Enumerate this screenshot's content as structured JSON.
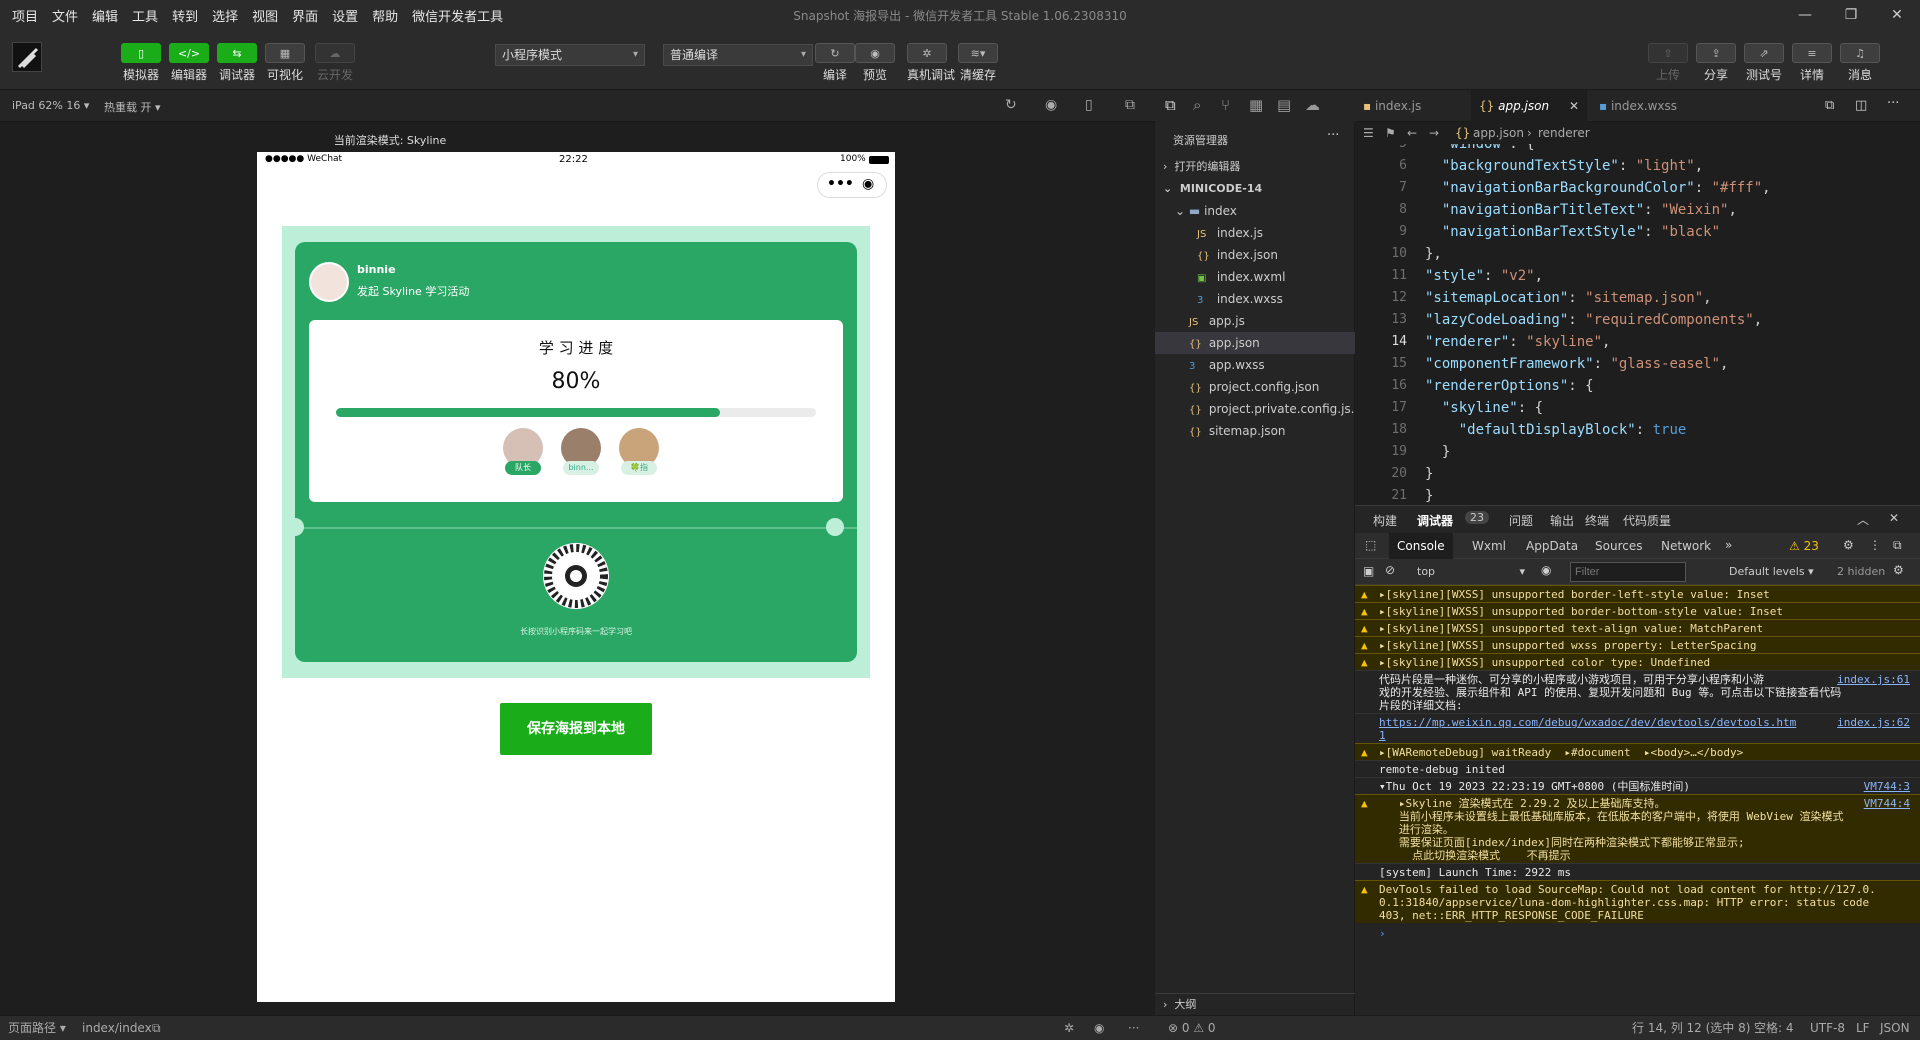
{
  "menu": [
    "项目",
    "文件",
    "编辑",
    "工具",
    "转到",
    "选择",
    "视图",
    "界面",
    "设置",
    "帮助",
    "微信开发者工具"
  ],
  "window_title": "Snapshot 海报导出 - 微信开发者工具 Stable 1.06.2308310",
  "toolbar": {
    "simulator": "模拟器",
    "editor": "编辑器",
    "debugger": "调试器",
    "visual": "可视化",
    "cloud": "云开发",
    "mode_select": "小程序模式",
    "compile_select": "普通编译",
    "compile": "编译",
    "preview": "预览",
    "real_debug": "真机调试",
    "clear_cache": "清缓存",
    "upload": "上传",
    "share": "分享",
    "test_account": "测试号",
    "details": "详情",
    "messages": "消息"
  },
  "sim": {
    "device": "iPad 62% 16 ▾",
    "hot_reload": "热重载 开 ▾",
    "render_mode": "当前渲染模式: Skyline",
    "status_left": "●●●●● WeChat",
    "status_time": "22:22",
    "status_battery": "100%"
  },
  "poster": {
    "username": "binnie",
    "subtitle": "发起 Skyline 学习活动",
    "progress_title": "学 习 进 度",
    "progress_text": "80%",
    "progress_value": 0.8,
    "avatars": [
      {
        "label": "队长",
        "color": "#d6bfb5"
      },
      {
        "label": "binn...",
        "color": "#9a7f6b"
      },
      {
        "label": "🍀指",
        "color": "#c9a37a"
      }
    ],
    "qr_caption": "长按识别小程序码来一起学习吧",
    "save_button": "保存海报到本地"
  },
  "explorer": {
    "title": "资源管理器",
    "open_editors": "打开的编辑器",
    "project": "MINICODE-14",
    "folder": "index",
    "files": [
      {
        "name": "index.js",
        "icon": "JS",
        "color": "#e5c07b",
        "indent": 2
      },
      {
        "name": "index.json",
        "icon": "{}",
        "color": "#e5c07b",
        "indent": 2
      },
      {
        "name": "index.wxml",
        "icon": "▣",
        "color": "#6cc644",
        "indent": 2
      },
      {
        "name": "index.wxss",
        "icon": "3",
        "color": "#569cd6",
        "indent": 2
      },
      {
        "name": "app.js",
        "icon": "JS",
        "color": "#e5c07b",
        "indent": 1
      },
      {
        "name": "app.json",
        "icon": "{}",
        "color": "#e5c07b",
        "indent": 1,
        "selected": true
      },
      {
        "name": "app.wxss",
        "icon": "3",
        "color": "#569cd6",
        "indent": 1
      },
      {
        "name": "project.config.json",
        "icon": "{}",
        "color": "#e5c07b",
        "indent": 1
      },
      {
        "name": "project.private.config.js...",
        "icon": "{}",
        "color": "#e5c07b",
        "indent": 1
      },
      {
        "name": "sitemap.json",
        "icon": "{}",
        "color": "#e5c07b",
        "indent": 1
      }
    ],
    "outline": "大纲",
    "problems": "⊗ 0 ⚠ 0"
  },
  "editor": {
    "tabs": [
      "index.js",
      "app.json",
      "index.wxss"
    ],
    "breadcrumb_file": "app.json",
    "breadcrumb_key": "renderer",
    "lines": [
      {
        "n": "5",
        "html": "  <span class=k>\"window\"</span>: {"
      },
      {
        "n": "6",
        "html": "  <span class=k>\"backgroundTextStyle\"</span>: <span class=s>\"light\"</span>,"
      },
      {
        "n": "7",
        "html": "  <span class=k>\"navigationBarBackgroundColor\"</span>: <span class=s>\"#fff\"</span>,"
      },
      {
        "n": "8",
        "html": "  <span class=k>\"navigationBarTitleText\"</span>: <span class=s>\"Weixin\"</span>,"
      },
      {
        "n": "9",
        "html": "  <span class=k>\"navigationBarTextStyle\"</span>: <span class=s>\"black\"</span>"
      },
      {
        "n": "10",
        "html": "},"
      },
      {
        "n": "11",
        "html": "<span class=k>\"style\"</span>: <span class=s>\"v2\"</span>,"
      },
      {
        "n": "12",
        "html": "<span class=k>\"sitemapLocation\"</span>: <span class=s>\"sitemap.json\"</span>,"
      },
      {
        "n": "13",
        "html": "<span class=k>\"lazyCodeLoading\"</span>: <span class=s>\"requiredComponents\"</span>,"
      },
      {
        "n": "14",
        "html": "<span class=k>\"renderer\"</span>: <span class=s>\"skyline\"</span>,"
      },
      {
        "n": "15",
        "html": "<span class=k>\"componentFramework\"</span>: <span class=s>\"glass-easel\"</span>,"
      },
      {
        "n": "16",
        "html": "<span class=k>\"rendererOptions\"</span>: {"
      },
      {
        "n": "17",
        "html": "  <span class=k>\"skyline\"</span>: {"
      },
      {
        "n": "18",
        "html": "    <span class=k>\"defaultDisplayBlock\"</span>: <span class=b>true</span>"
      },
      {
        "n": "19",
        "html": "  }"
      },
      {
        "n": "20",
        "html": "}"
      },
      {
        "n": "21",
        "html": "}"
      }
    ]
  },
  "devtools": {
    "tabs": [
      "构建",
      "调试器",
      "23",
      "问题",
      "输出",
      "终端",
      "代码质量"
    ],
    "sub_tabs": [
      "Console",
      "Wxml",
      "AppData",
      "Sources",
      "Network"
    ],
    "warn_count": "⚠ 23",
    "context": "top",
    "filter_placeholder": "Filter",
    "levels": "Default levels ▾",
    "hidden": "2 hidden",
    "logs": [
      {
        "type": "warn",
        "text": "▸[skyline][WXSS] unsupported border-left-style value: Inset",
        "lines": 1
      },
      {
        "type": "warn",
        "text": "▸[skyline][WXSS] unsupported border-bottom-style value: Inset",
        "lines": 1
      },
      {
        "type": "warn",
        "text": "▸[skyline][WXSS] unsupported text-align value: MatchParent",
        "lines": 1
      },
      {
        "type": "warn",
        "text": "▸[skyline][WXSS] unsupported wxss property: LetterSpacing",
        "lines": 1
      },
      {
        "type": "warn",
        "text": "▸[skyline][WXSS] unsupported color type: Undefined",
        "lines": 1
      },
      {
        "type": "log",
        "text": "代码片段是一种迷你、可分享的小程序或小游戏项目，可用于分享小程序和小游\n戏的开发经验、展示组件和 API 的使用、复现开发问题和 Bug 等。可点击以下链接查看代码\n片段的详细文档:",
        "src": "index.js:61",
        "lines": 3
      },
      {
        "type": "log",
        "text": "https://mp.weixin.qq.com/debug/wxadoc/dev/devtools/devtools.htm\n1",
        "src": "index.js:62",
        "lines": 2,
        "link": true
      },
      {
        "type": "warn",
        "text": "▸[WARemoteDebug] waitReady  ▸#document  ▸<body>…</body>",
        "lines": 1
      },
      {
        "type": "log",
        "text": "remote-debug inited",
        "lines": 1
      },
      {
        "type": "log",
        "text": "▾Thu Oct 19 2023 22:23:19 GMT+0800 (中国标准时间)",
        "src": "VM744:3",
        "lines": 1
      },
      {
        "type": "warn",
        "text": "   ▸Skyline 渲染模式在 2.29.2 及以上基础库支持。\n   当前小程序未设置线上最低基础库版本，在低版本的客户端中，将使用 WebView 渲染模式\n   进行渲染。\n   需要保证页面[index/index]同时在两种渲染模式下都能够正常显示;\n     点此切换渲染模式    不再提示",
        "src": "VM744:4",
        "lines": 5
      },
      {
        "type": "log",
        "text": "[system] Launch Time: 2922 ms",
        "lines": 1
      },
      {
        "type": "warn",
        "text": "DevTools failed to load SourceMap: Could not load content for http://127.0.\n0.1:31840/appservice/luna-dom-highlighter.css.map: HTTP error: status code\n403, net::ERR_HTTP_RESPONSE_CODE_FAILURE",
        "lines": 3
      }
    ],
    "prompt": "›"
  },
  "statusbar": {
    "page_path_label": "页面路径 ▾",
    "page_path": "index/index",
    "position": "行 14, 列 12 (选中 8)",
    "indent": "空格: 4",
    "encoding": "UTF-8",
    "eol": "LF",
    "language": "JSON"
  }
}
